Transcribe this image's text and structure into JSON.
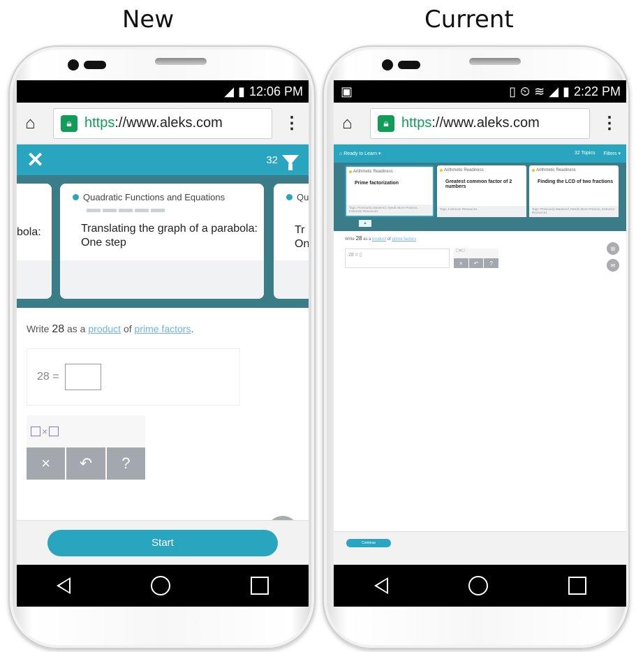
{
  "captions": {
    "left": "New",
    "right": "Current"
  },
  "new_phone": {
    "status_time": "12:06 PM",
    "url_scheme": "https",
    "url_rest": "://www.aleks.com",
    "filter_count": "32",
    "cards": [
      {
        "category": "",
        "title": "bola:"
      },
      {
        "category": "Quadratic Functions and Equations",
        "title": "Translating the graph of a parabola: One step"
      },
      {
        "category": "Qu",
        "title": "Tr\nOn"
      }
    ],
    "question": {
      "prefix": "Write",
      "number": "28",
      "mid": "as a",
      "link1": "product",
      "of": "of",
      "link2": "prime factors",
      "end": "."
    },
    "answer_prefix": "28 =",
    "keypad": {
      "template": "□×□",
      "clear": "×",
      "undo": "↶",
      "help": "?"
    },
    "start_label": "Start"
  },
  "current_phone": {
    "status_time": "2:22 PM",
    "url_scheme": "https",
    "url_rest": "://www.aleks.com",
    "top_left": "Ready to Learn ▾",
    "top_topics": "32 Topics",
    "top_filters": "Filters ▾",
    "cards": [
      {
        "category": "Arithmetic Readiness",
        "title": "Prime factorization",
        "tags": "Tags: Previously Mastered, Needs More Practice, Instructor Resources"
      },
      {
        "category": "Arithmetic Readiness",
        "title": "Greatest common factor of 2 numbers",
        "tags": "Tags: Instructor Resources"
      },
      {
        "category": "Arithmetic Readiness",
        "title": "Finding the LCD of two fractions",
        "tags": "Tags: Previously Mastered, Needs More Practice, Instructor Resources"
      }
    ],
    "question": {
      "prefix": "Write",
      "number": "28",
      "mid": "as a",
      "link1": "product",
      "of": "of",
      "link2": "prime factors"
    },
    "answer_prefix": "28 =",
    "keypad": {
      "template": "□×□",
      "clear": "×",
      "undo": "↶",
      "help": "?"
    },
    "continue_label": "Continue"
  }
}
